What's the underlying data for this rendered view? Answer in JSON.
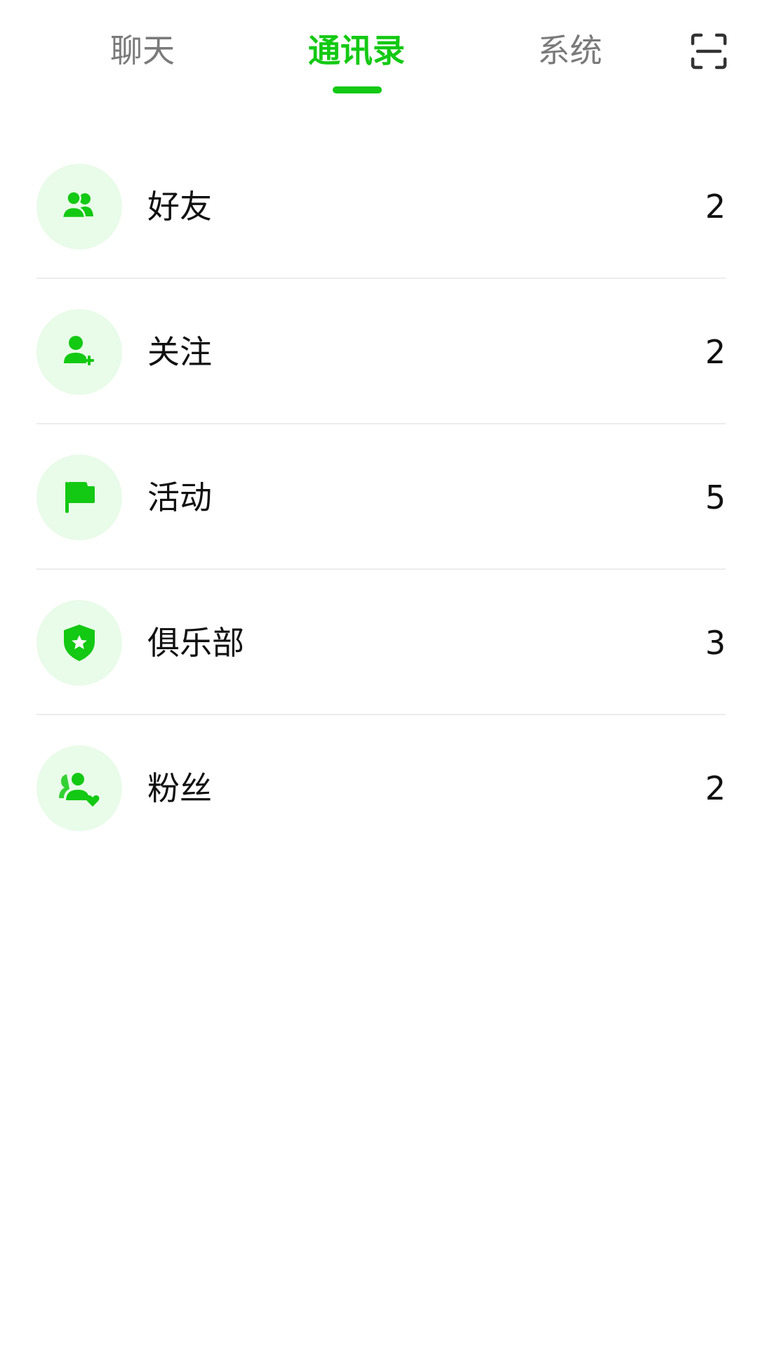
{
  "tabs": [
    {
      "label": "聊天",
      "active": false
    },
    {
      "label": "通讯录",
      "active": true
    },
    {
      "label": "系统",
      "active": false
    }
  ],
  "colors": {
    "accent": "#13c913",
    "inactive_tab": "#7a7a7a",
    "avatar_bg": "#e9fbe9",
    "divider": "#ececec",
    "text": "#111111"
  },
  "scan_icon": "scan-icon",
  "contacts": [
    {
      "label": "好友",
      "count": "2",
      "icon": "friends-icon"
    },
    {
      "label": "关注",
      "count": "2",
      "icon": "user-add-icon"
    },
    {
      "label": "活动",
      "count": "5",
      "icon": "flag-icon"
    },
    {
      "label": "俱乐部",
      "count": "3",
      "icon": "shield-star-icon"
    },
    {
      "label": "粉丝",
      "count": "2",
      "icon": "fans-heart-icon"
    }
  ]
}
